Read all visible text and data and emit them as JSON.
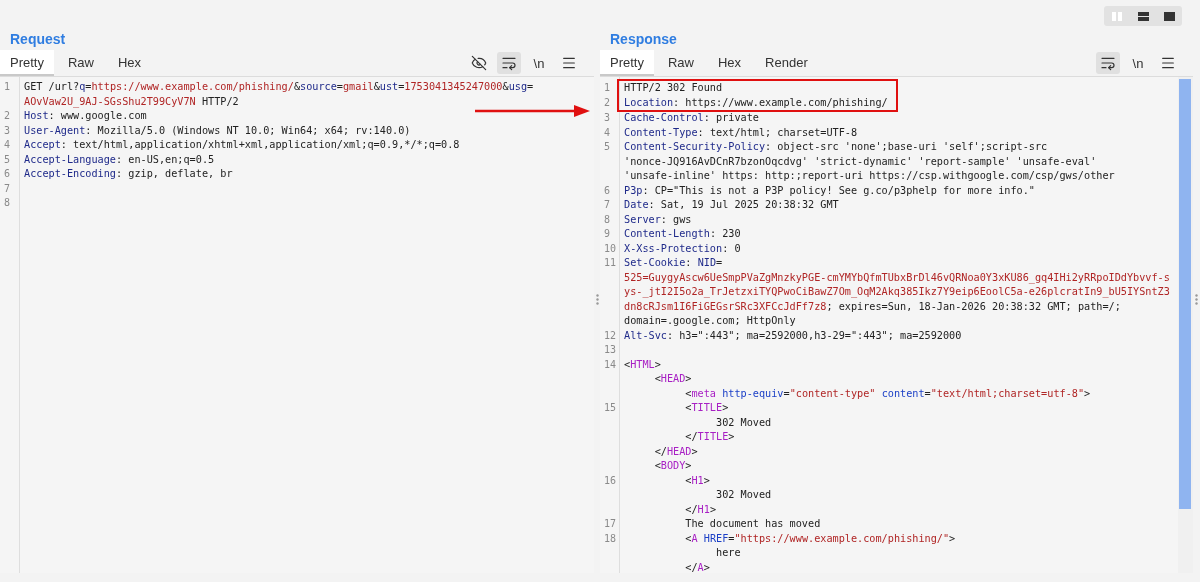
{
  "layout_buttons": [
    {
      "kind": "columns"
    },
    {
      "kind": "rows"
    },
    {
      "kind": "single"
    }
  ],
  "request": {
    "title": "Request",
    "tabs": [
      {
        "label": "Pretty",
        "selected": true
      },
      {
        "label": "Raw",
        "selected": false
      },
      {
        "label": "Hex",
        "selected": false
      }
    ],
    "tools": [
      {
        "kind": "hide",
        "selected": false
      },
      {
        "kind": "wrap",
        "selected": true
      },
      {
        "kind": "newline",
        "label": "\\n",
        "selected": false
      },
      {
        "kind": "menu",
        "selected": false
      }
    ],
    "rows": [
      {
        "num": "1",
        "segs": [
          {
            "kind": "plain",
            "text": "GET /url?"
          },
          {
            "kind": "key",
            "text": "q"
          },
          {
            "kind": "plain",
            "text": "="
          },
          {
            "kind": "value",
            "text": "https://www.example.com/phishing/"
          },
          {
            "kind": "plain",
            "text": "&"
          },
          {
            "kind": "key",
            "text": "source"
          },
          {
            "kind": "plain",
            "text": "="
          },
          {
            "kind": "value",
            "text": "gmail"
          },
          {
            "kind": "plain",
            "text": "&"
          },
          {
            "kind": "key",
            "text": "ust"
          },
          {
            "kind": "plain",
            "text": "="
          },
          {
            "kind": "value",
            "text": "1753041345247000"
          },
          {
            "kind": "plain",
            "text": "&"
          },
          {
            "kind": "key",
            "text": "usg"
          },
          {
            "kind": "plain",
            "text": "="
          }
        ]
      },
      {
        "segs": [
          {
            "kind": "value",
            "text": "AOvVaw2U_9AJ-SGsShu2T99CyV7N"
          },
          {
            "kind": "plain",
            "text": " HTTP/2"
          }
        ]
      },
      {
        "num": "2",
        "segs": [
          {
            "kind": "key",
            "text": "Host"
          },
          {
            "kind": "plain",
            "text": ": www.google.com"
          }
        ]
      },
      {
        "num": "3",
        "segs": [
          {
            "kind": "key",
            "text": "User-Agent"
          },
          {
            "kind": "plain",
            "text": ": Mozilla/5.0 (Windows NT 10.0; Win64; x64; rv:140.0)"
          }
        ]
      },
      {
        "num": "4",
        "segs": [
          {
            "kind": "key",
            "text": "Accept"
          },
          {
            "kind": "plain",
            "text": ": text/html,application/xhtml+xml,application/xml;q=0.9,*/*;q=0.8"
          }
        ]
      },
      {
        "num": "5",
        "segs": [
          {
            "kind": "key",
            "text": "Accept-Language"
          },
          {
            "kind": "plain",
            "text": ": en-US,en;q=0.5"
          }
        ]
      },
      {
        "num": "6",
        "segs": [
          {
            "kind": "key",
            "text": "Accept-Encoding"
          },
          {
            "kind": "plain",
            "text": ": gzip, deflate, br"
          }
        ]
      },
      {
        "num": "7"
      },
      {
        "num": "8"
      }
    ]
  },
  "response": {
    "title": "Response",
    "tabs": [
      {
        "label": "Pretty",
        "selected": true
      },
      {
        "label": "Raw",
        "selected": false
      },
      {
        "label": "Hex",
        "selected": false
      },
      {
        "label": "Render",
        "selected": false
      }
    ],
    "tools": [
      {
        "kind": "wrap",
        "selected": true
      },
      {
        "kind": "newline",
        "label": "\\n",
        "selected": false
      },
      {
        "kind": "menu",
        "selected": false
      }
    ],
    "boxed_rows": [
      {
        "num": "1",
        "segs": [
          {
            "kind": "plain",
            "text": "HTTP/2 302 Found"
          }
        ]
      },
      {
        "num": "2",
        "segs": [
          {
            "kind": "key",
            "text": "Location"
          },
          {
            "kind": "plain",
            "text": ": https://www.example.com/phishing/"
          }
        ]
      }
    ],
    "rows": [
      {
        "num": "3",
        "segs": [
          {
            "kind": "key",
            "text": "Cache-Control"
          },
          {
            "kind": "plain",
            "text": ": private"
          }
        ]
      },
      {
        "num": "4",
        "segs": [
          {
            "kind": "key",
            "text": "Content-Type"
          },
          {
            "kind": "plain",
            "text": ": text/html; charset=UTF-8"
          }
        ]
      },
      {
        "num": "5",
        "segs": [
          {
            "kind": "key",
            "text": "Content-Security-Policy"
          },
          {
            "kind": "plain",
            "text": ": object-src 'none';base-uri 'self';script-src"
          }
        ]
      },
      {
        "segs": [
          {
            "kind": "plain",
            "text": "'nonce-JQ916AvDCnR7bzonOqcdvg' 'strict-dynamic' 'report-sample' 'unsafe-eval'"
          }
        ]
      },
      {
        "segs": [
          {
            "kind": "plain",
            "text": "'unsafe-inline' https: http:;report-uri https://csp.withgoogle.com/csp/gws/other"
          }
        ]
      },
      {
        "num": "6",
        "segs": [
          {
            "kind": "key",
            "text": "P3p"
          },
          {
            "kind": "plain",
            "text": ": CP=\"This is not a P3P policy! See g.co/p3phelp for more info.\""
          }
        ]
      },
      {
        "num": "7",
        "segs": [
          {
            "kind": "key",
            "text": "Date"
          },
          {
            "kind": "plain",
            "text": ": Sat, 19 Jul 2025 20:38:32 GMT"
          }
        ]
      },
      {
        "num": "8",
        "segs": [
          {
            "kind": "key",
            "text": "Server"
          },
          {
            "kind": "plain",
            "text": ": gws"
          }
        ]
      },
      {
        "num": "9",
        "segs": [
          {
            "kind": "key",
            "text": "Content-Length"
          },
          {
            "kind": "plain",
            "text": ": 230"
          }
        ]
      },
      {
        "num": "10",
        "segs": [
          {
            "kind": "key",
            "text": "X-Xss-Protection"
          },
          {
            "kind": "plain",
            "text": ": 0"
          }
        ]
      },
      {
        "num": "11",
        "segs": [
          {
            "kind": "key",
            "text": "Set-Cookie"
          },
          {
            "kind": "plain",
            "text": ": "
          },
          {
            "kind": "key",
            "text": "NID"
          },
          {
            "kind": "plain",
            "text": "="
          }
        ]
      },
      {
        "segs": [
          {
            "kind": "value",
            "text": "525=GuygyAscw6UeSmpPVaZgMnzkyPGE-cmYMYbQfmTUbxBrDl46vQRNoa0Y3xKU86_gq4IHi2yRRpoIDdYbvvf-s"
          }
        ]
      },
      {
        "segs": [
          {
            "kind": "value",
            "text": "ys-_jtI2I5o2a_TrJetzxiTYQPwoCiBawZ7Om_OqM2Akq385Ikz7Y9eip6EoolC5a-e26plcratIn9_bU5IYSntZ3"
          }
        ]
      },
      {
        "segs": [
          {
            "kind": "value",
            "text": "dn8cRJsm1I6FiGEGsrSRc3XFCcJdFf7z8"
          },
          {
            "kind": "plain",
            "text": "; expires=Sun, 18-Jan-2026 20:38:32 GMT; path=/;"
          }
        ]
      },
      {
        "segs": [
          {
            "kind": "plain",
            "text": "domain=.google.com; HttpOnly"
          }
        ]
      },
      {
        "num": "12",
        "segs": [
          {
            "kind": "key",
            "text": "Alt-Svc"
          },
          {
            "kind": "plain",
            "text": ": h3=\":443\"; ma=2592000,h3-29=\":443\"; ma=2592000"
          }
        ]
      },
      {
        "num": "13"
      },
      {
        "num": "14",
        "segs": [
          {
            "kind": "plain",
            "text": "<"
          },
          {
            "kind": "tag",
            "text": "HTML"
          },
          {
            "kind": "plain",
            "text": ">"
          }
        ]
      },
      {
        "segs": [
          {
            "kind": "plain",
            "text": "     <"
          },
          {
            "kind": "tag",
            "text": "HEAD"
          },
          {
            "kind": "plain",
            "text": ">"
          }
        ]
      },
      {
        "segs": [
          {
            "kind": "plain",
            "text": "          <"
          },
          {
            "kind": "tag",
            "text": "meta"
          },
          {
            "kind": "attr",
            "text": " http-equiv"
          },
          {
            "kind": "plain",
            "text": "="
          },
          {
            "kind": "value",
            "text": "\"content-type\""
          },
          {
            "kind": "attr",
            "text": " content"
          },
          {
            "kind": "plain",
            "text": "="
          },
          {
            "kind": "value",
            "text": "\"text/html;charset=utf-8\""
          },
          {
            "kind": "plain",
            "text": ">"
          }
        ]
      },
      {
        "num": "15",
        "segs": [
          {
            "kind": "plain",
            "text": "          <"
          },
          {
            "kind": "tag",
            "text": "TITLE"
          },
          {
            "kind": "plain",
            "text": ">"
          }
        ]
      },
      {
        "segs": [
          {
            "kind": "plain",
            "text": "               302 Moved"
          }
        ]
      },
      {
        "segs": [
          {
            "kind": "plain",
            "text": "          </"
          },
          {
            "kind": "tag",
            "text": "TITLE"
          },
          {
            "kind": "plain",
            "text": ">"
          }
        ]
      },
      {
        "segs": [
          {
            "kind": "plain",
            "text": "     </"
          },
          {
            "kind": "tag",
            "text": "HEAD"
          },
          {
            "kind": "plain",
            "text": ">"
          }
        ]
      },
      {
        "segs": [
          {
            "kind": "plain",
            "text": "     <"
          },
          {
            "kind": "tag",
            "text": "BODY"
          },
          {
            "kind": "plain",
            "text": ">"
          }
        ]
      },
      {
        "num": "16",
        "segs": [
          {
            "kind": "plain",
            "text": "          <"
          },
          {
            "kind": "tag",
            "text": "H1"
          },
          {
            "kind": "plain",
            "text": ">"
          }
        ]
      },
      {
        "segs": [
          {
            "kind": "plain",
            "text": "               302 Moved"
          }
        ]
      },
      {
        "segs": [
          {
            "kind": "plain",
            "text": "          </"
          },
          {
            "kind": "tag",
            "text": "H1"
          },
          {
            "kind": "plain",
            "text": ">"
          }
        ]
      },
      {
        "num": "17",
        "segs": [
          {
            "kind": "plain",
            "text": "          The document has moved"
          }
        ]
      },
      {
        "num": "18",
        "segs": [
          {
            "kind": "plain",
            "text": "          <"
          },
          {
            "kind": "tag",
            "text": "A"
          },
          {
            "kind": "attr",
            "text": " HREF"
          },
          {
            "kind": "plain",
            "text": "="
          },
          {
            "kind": "value",
            "text": "\"https://www.example.com/phishing/\""
          },
          {
            "kind": "plain",
            "text": ">"
          }
        ]
      },
      {
        "segs": [
          {
            "kind": "plain",
            "text": "               here"
          }
        ]
      },
      {
        "segs": [
          {
            "kind": "plain",
            "text": "          </"
          },
          {
            "kind": "tag",
            "text": "A"
          },
          {
            "kind": "plain",
            "text": ">"
          }
        ]
      }
    ]
  }
}
